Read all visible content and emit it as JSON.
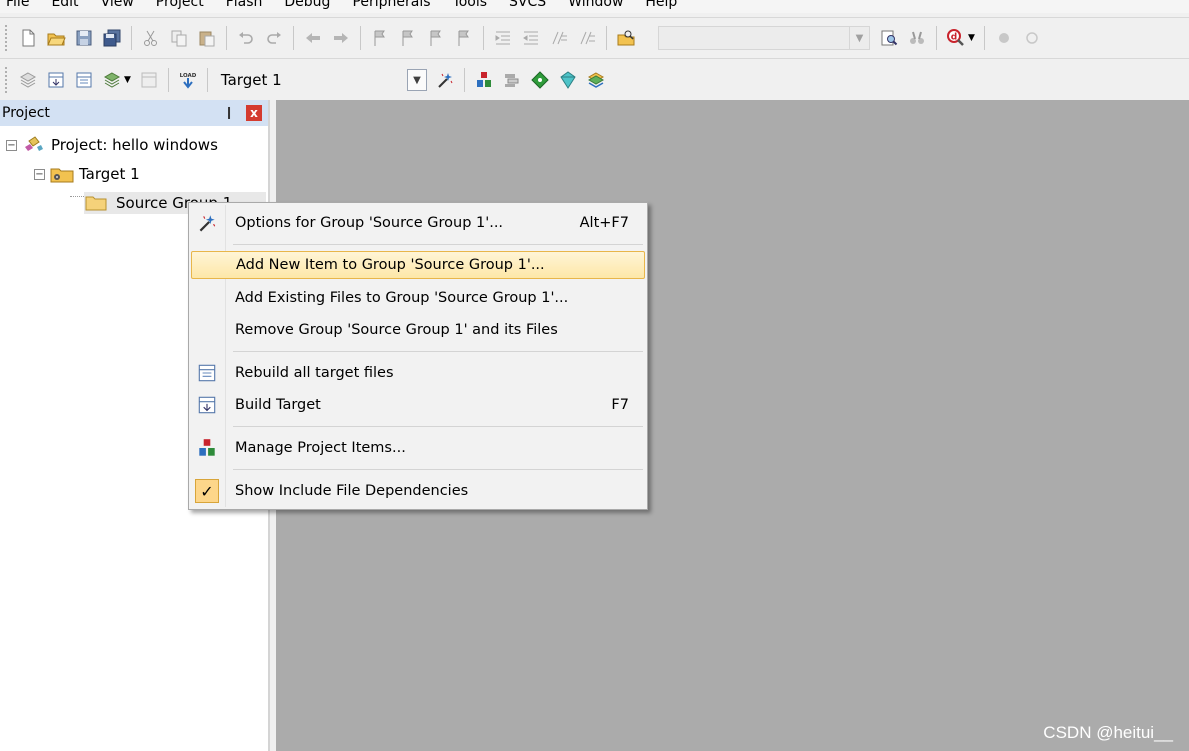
{
  "menu": [
    "File",
    "Edit",
    "View",
    "Project",
    "Flash",
    "Debug",
    "Peripherals",
    "Tools",
    "SVCS",
    "Window",
    "Help"
  ],
  "toolbar2": {
    "target_select": "Target 1"
  },
  "project_panel": {
    "title": "Project",
    "pin_glyph": "❙",
    "close_glyph": "x",
    "tree": {
      "root": "Project: hello windows",
      "target": "Target 1",
      "group": "Source Group 1"
    }
  },
  "context_menu": {
    "items": [
      {
        "label": "Options for Group 'Source Group 1'...",
        "shortcut": "Alt+F7"
      },
      {
        "label": "Add New  Item to Group 'Source Group 1'...",
        "shortcut": ""
      },
      {
        "label": "Add Existing Files to Group 'Source Group 1'...",
        "shortcut": ""
      },
      {
        "label": "Remove Group 'Source Group 1' and its Files",
        "shortcut": ""
      },
      {
        "label": "Rebuild all target files",
        "shortcut": ""
      },
      {
        "label": "Build Target",
        "shortcut": "F7"
      },
      {
        "label": "Manage Project Items...",
        "shortcut": ""
      },
      {
        "label": "Show Include File Dependencies",
        "shortcut": ""
      }
    ],
    "check_glyph": "✓"
  },
  "watermark": "CSDN @heitui__",
  "colors": {
    "panel_header": "#d3e1f3",
    "editor_bg": "#ababab",
    "highlight": "#fde7a8",
    "close_red": "#d43b2f"
  }
}
